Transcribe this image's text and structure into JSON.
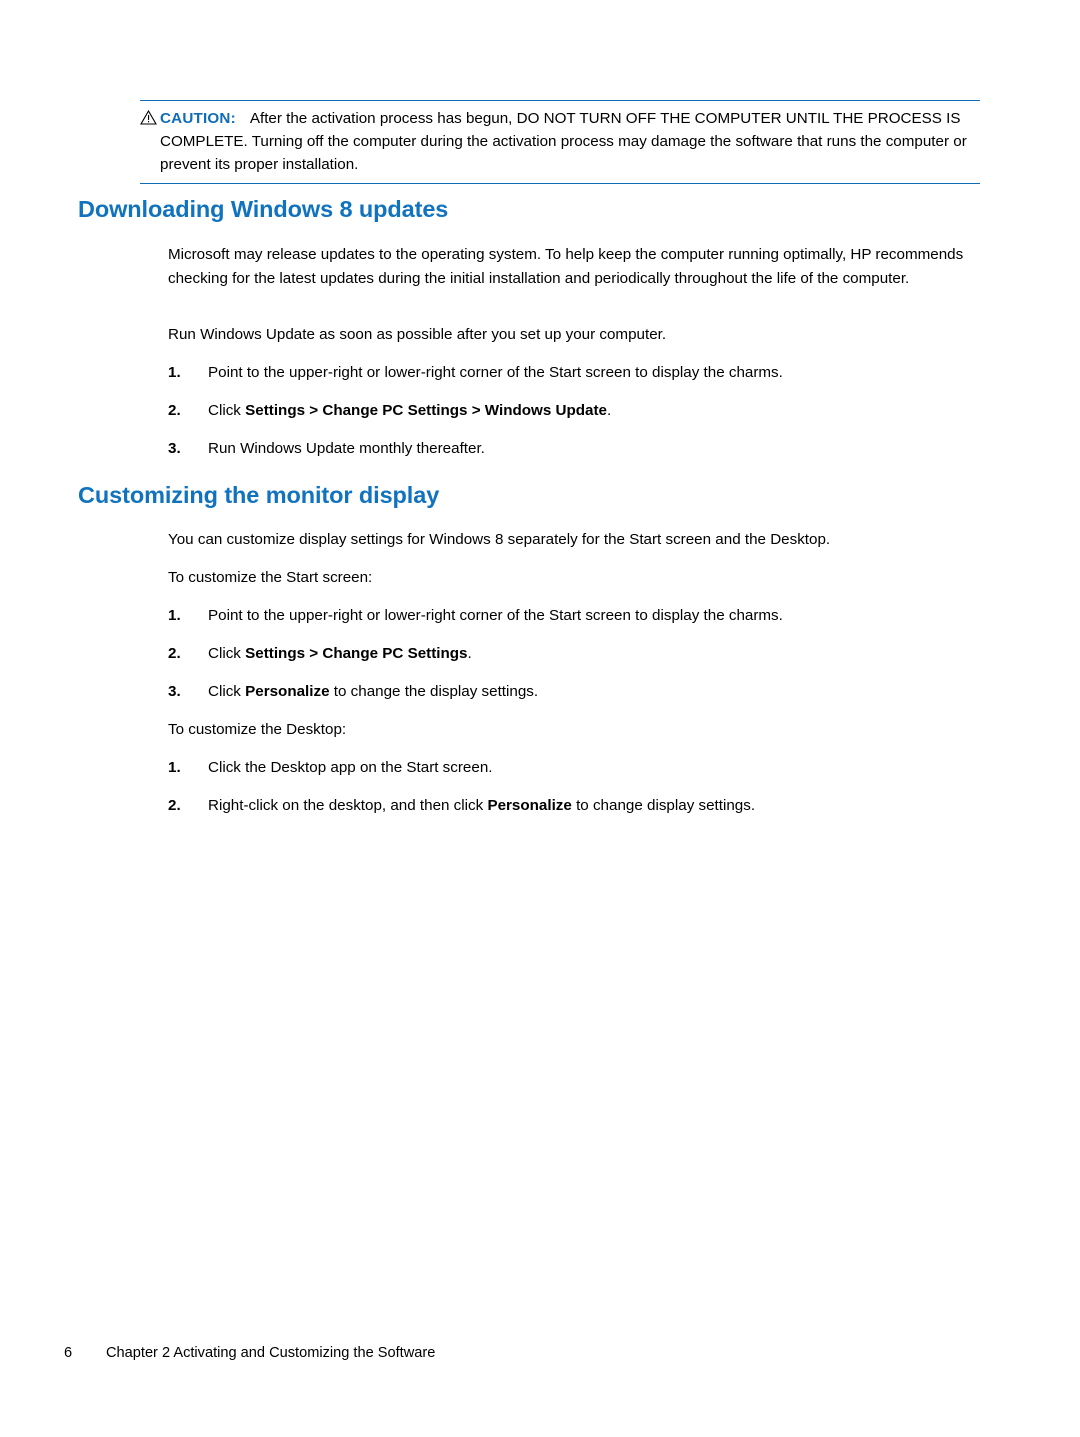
{
  "caution": {
    "icon": "warning-triangle-icon",
    "label": "CAUTION:",
    "text": "After the activation process has begun, DO NOT TURN OFF THE COMPUTER UNTIL THE PROCESS IS COMPLETE. Turning off the computer during the activation process may damage the software that runs the computer or prevent its proper installation."
  },
  "sections": [
    {
      "title": "Downloading Windows 8 updates",
      "intro": "Microsoft may release updates to the operating system. To help keep the computer running optimally, HP recommends checking for the latest updates during the initial installation and periodically throughout the life of the computer.",
      "lead": "Run Windows Update as soon as possible after you set up your computer.",
      "steps": [
        {
          "num": "1.",
          "pre": "Point to the upper-right or lower-right corner of the Start screen to display the charms.",
          "bold": "",
          "post": ""
        },
        {
          "num": "2.",
          "pre": "Click ",
          "bold": "Settings > Change PC Settings > Windows Update",
          "post": "."
        },
        {
          "num": "3.",
          "pre": "Run Windows Update monthly thereafter.",
          "bold": "",
          "post": ""
        }
      ]
    },
    {
      "title": "Customizing the monitor display",
      "intro": "You can customize display settings for Windows 8 separately for the Start screen and the Desktop.",
      "lead": "To customize the Start screen:",
      "steps": [
        {
          "num": "1.",
          "pre": "Point to the upper-right or lower-right corner of the Start screen to display the charms.",
          "bold": "",
          "post": ""
        },
        {
          "num": "2.",
          "pre": "Click ",
          "bold": "Settings > Change PC Settings",
          "post": "."
        },
        {
          "num": "3.",
          "pre": "Click ",
          "bold": "Personalize",
          "post": " to change the display settings."
        }
      ],
      "lead2": "To customize the Desktop:",
      "steps2": [
        {
          "num": "1.",
          "pre": "Click the Desktop app on the Start screen.",
          "bold": "",
          "post": ""
        },
        {
          "num": "2.",
          "pre": "Right-click on the desktop, and then click ",
          "bold": "Personalize",
          "post": " to change display settings."
        }
      ]
    }
  ],
  "footer": {
    "page_number": "6",
    "text": "Chapter 2   Activating and Customizing the Software"
  }
}
